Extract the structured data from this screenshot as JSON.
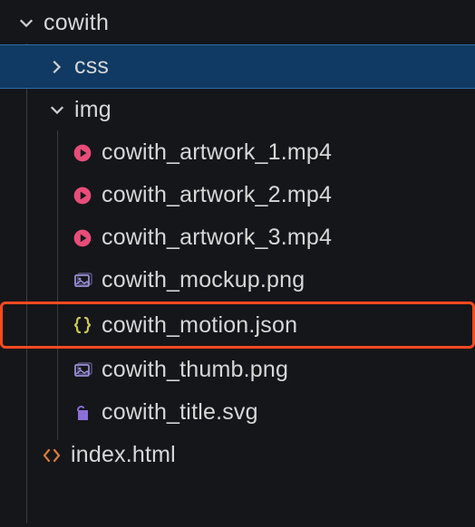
{
  "tree": {
    "root": {
      "name": "cowith",
      "expanded": true,
      "children": [
        {
          "type": "folder",
          "name": "css",
          "expanded": false,
          "selected": true
        },
        {
          "type": "folder",
          "name": "img",
          "expanded": true,
          "children": [
            {
              "type": "file",
              "name": "cowith_artwork_1.mp4",
              "icon": "video"
            },
            {
              "type": "file",
              "name": "cowith_artwork_2.mp4",
              "icon": "video"
            },
            {
              "type": "file",
              "name": "cowith_artwork_3.mp4",
              "icon": "video"
            },
            {
              "type": "file",
              "name": "cowith_mockup.png",
              "icon": "image"
            },
            {
              "type": "file",
              "name": "cowith_motion.json",
              "icon": "json",
              "highlighted": true
            },
            {
              "type": "file",
              "name": "cowith_thumb.png",
              "icon": "image"
            },
            {
              "type": "file",
              "name": "cowith_title.svg",
              "icon": "svg"
            }
          ]
        },
        {
          "type": "file",
          "name": "index.html",
          "icon": "html"
        }
      ]
    }
  },
  "colors": {
    "video": "#e84d79",
    "image": "#9a8fd8",
    "json": "#cbca58",
    "svg": "#8c6fd6",
    "html": "#d67b3b",
    "chevron": "#d0d0d0",
    "selectedBg": "#103a63"
  }
}
